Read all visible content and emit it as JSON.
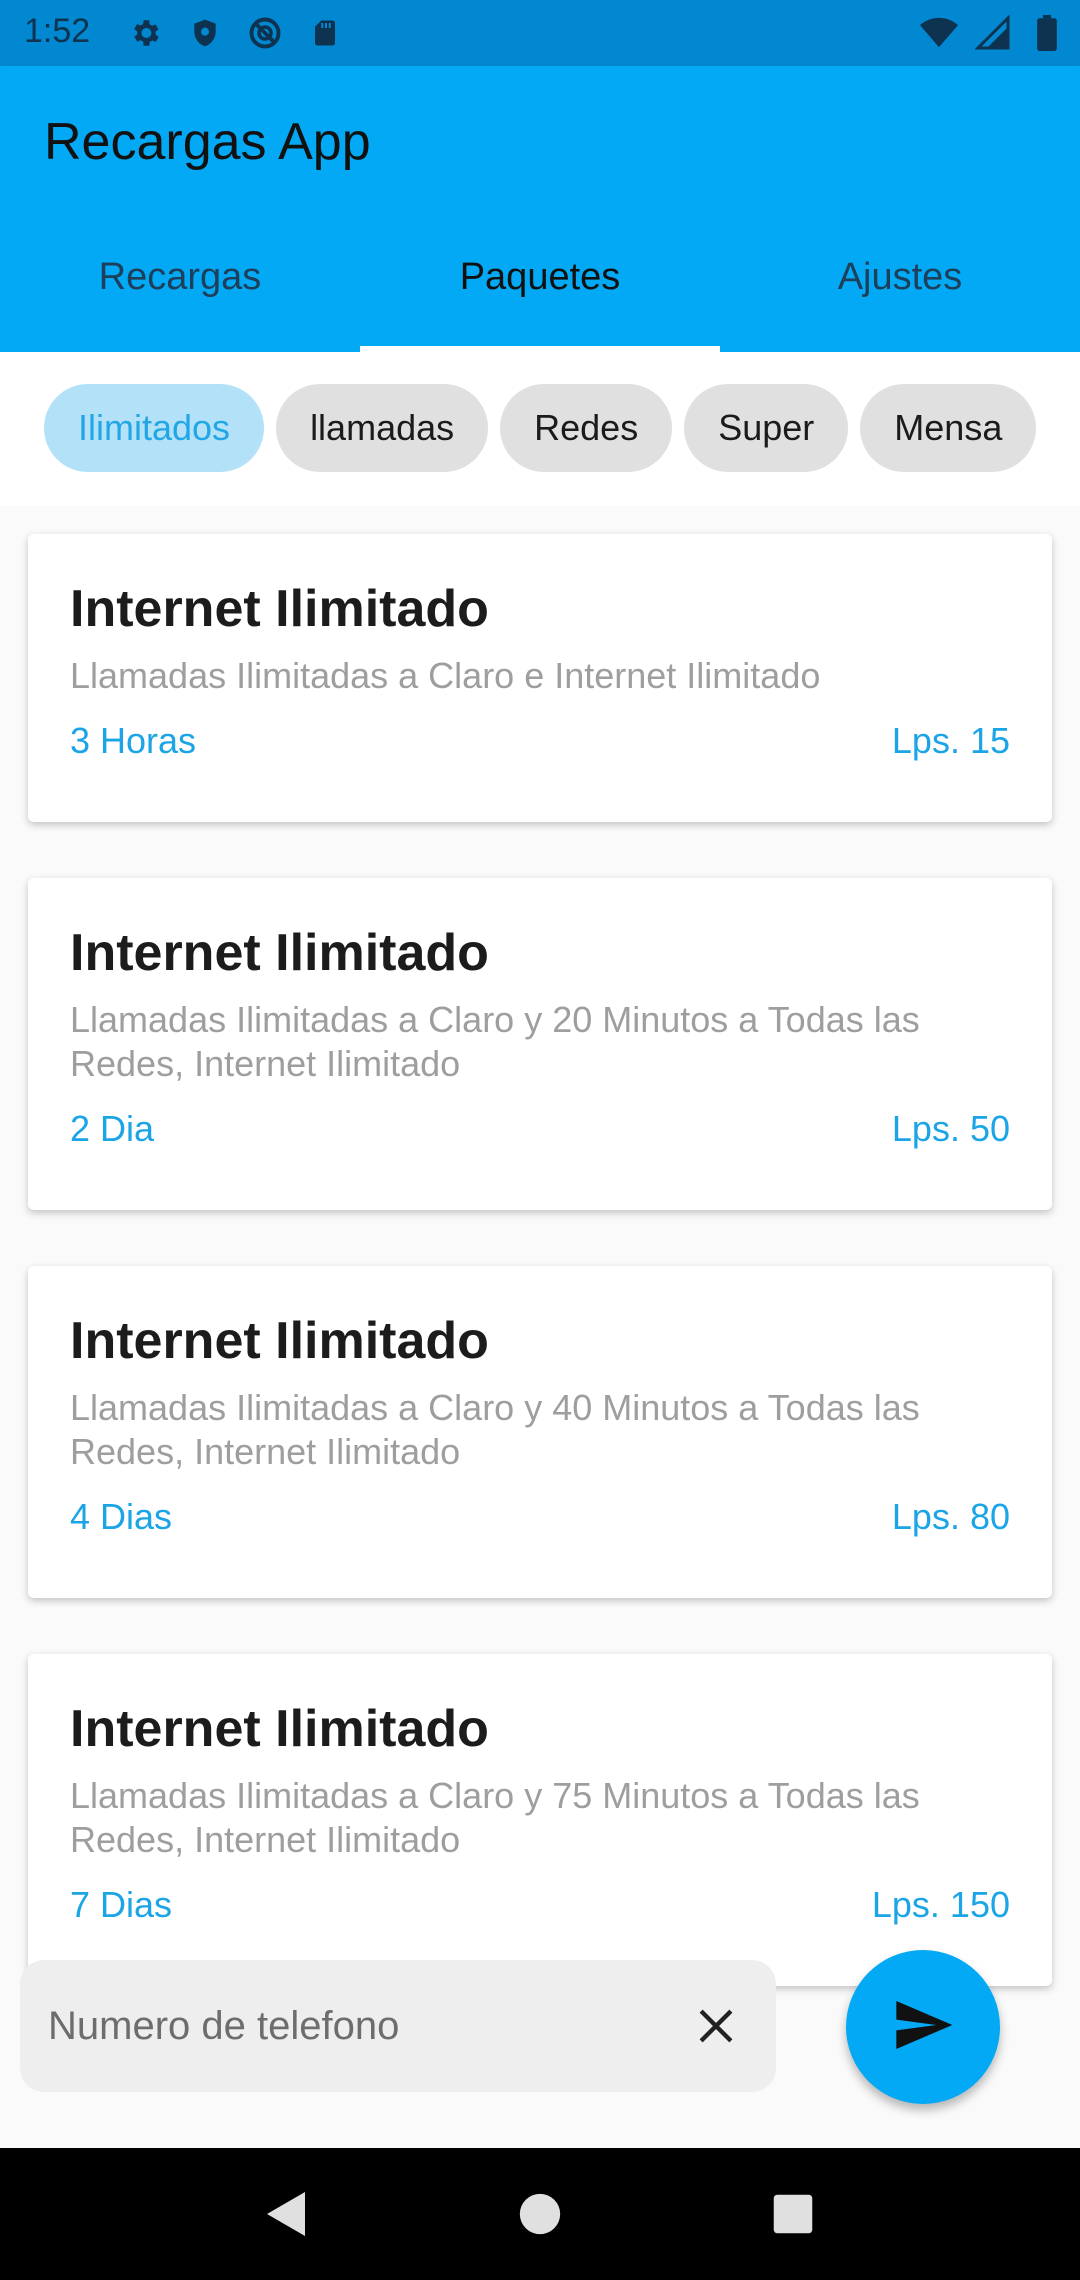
{
  "status_bar": {
    "time": "1:52",
    "icons_left": [
      "gear-icon",
      "shield-icon",
      "no-sync-icon",
      "sd-card-icon"
    ],
    "icons_right": [
      "wifi-icon",
      "signal-icon",
      "battery-icon"
    ]
  },
  "app_bar": {
    "title": "Recargas App",
    "tabs": [
      {
        "label": "Recargas",
        "active": false
      },
      {
        "label": "Paquetes",
        "active": true
      },
      {
        "label": "Ajustes",
        "active": false
      }
    ]
  },
  "filters": {
    "chips": [
      {
        "label": "Ilimitados",
        "active": true
      },
      {
        "label": "llamadas",
        "active": false
      },
      {
        "label": "Redes",
        "active": false
      },
      {
        "label": "Super",
        "active": false
      },
      {
        "label": "Mensa",
        "active": false
      }
    ]
  },
  "packages": [
    {
      "title": "Internet Ilimitado",
      "description": "Llamadas Ilimitadas a Claro e Internet Ilimitado",
      "duration": "3 Horas",
      "price": "Lps. 15"
    },
    {
      "title": "Internet Ilimitado",
      "description": "Llamadas Ilimitadas a Claro y 20 Minutos a Todas las Redes, Internet Ilimitado",
      "duration": "2 Dia",
      "price": "Lps. 50"
    },
    {
      "title": "Internet Ilimitado",
      "description": "Llamadas Ilimitadas a Claro y 40 Minutos a Todas las Redes, Internet Ilimitado",
      "duration": "4 Dias",
      "price": "Lps. 80"
    },
    {
      "title": "Internet Ilimitado",
      "description": "Llamadas Ilimitadas a Claro y 75 Minutos a Todas las Redes, Internet Ilimitado",
      "duration": "7 Dias",
      "price": "Lps. 150"
    }
  ],
  "phone_input": {
    "placeholder": "Numero de telefono",
    "value": ""
  },
  "colors": {
    "primary": "#03a9f4",
    "status_bar": "#0288d1",
    "accent_text": "#1ba4e6",
    "chip_active_bg": "#b3e1f8"
  }
}
